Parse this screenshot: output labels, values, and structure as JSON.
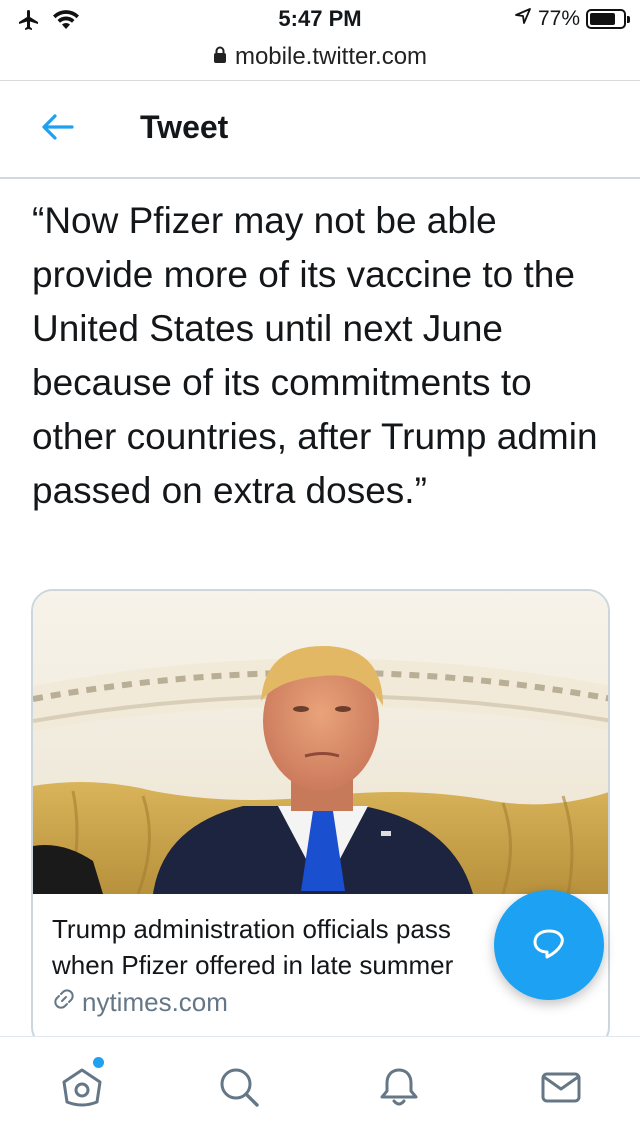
{
  "status_bar": {
    "time": "5:47 PM",
    "battery_percent": "77%",
    "battery_level": 0.77,
    "icons": [
      "airplane-icon",
      "wifi-icon",
      "location-arrow-icon",
      "battery-icon"
    ]
  },
  "browser": {
    "url": "mobile.twitter.com"
  },
  "header": {
    "title": "Tweet"
  },
  "tweet": {
    "text": "“Now Pfizer may not be able provide more of its vaccine to the United States until next June because of its commitments to other countries, after Trump admin passed on extra doses.”"
  },
  "card": {
    "title_line1": "Trump administration officials pass",
    "title_line2": "when Pfizer offered in late summer",
    "domain": "nytimes.com"
  },
  "fab": {
    "icon": "reply-bubble-icon"
  },
  "bottom_nav": {
    "items": [
      "home-icon",
      "search-icon",
      "notifications-icon",
      "messages-icon"
    ],
    "accent": "#1da1f2"
  },
  "colors": {
    "accent": "#1da1f2",
    "text": "#14171a",
    "secondary": "#657786"
  }
}
